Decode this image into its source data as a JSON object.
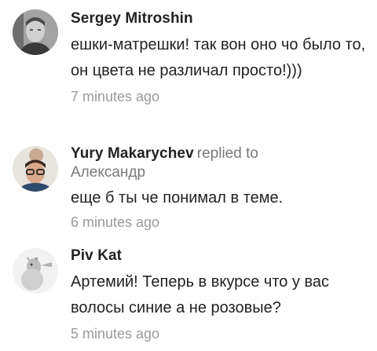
{
  "comments": [
    {
      "author": "Sergey Mitroshin",
      "text": "ешки-матрешки! так вон оно чо было то, он цвета не различал просто!)))",
      "time": "7 minutes ago",
      "avatar_icon": "user-photo-avatar"
    },
    {
      "author": "Yury Makarychev",
      "replied_label": "replied to",
      "reply_target": "Александр",
      "text": "еще б ты че понимал в теме.",
      "time": "6 minutes ago",
      "avatar_icon": "user-photo-avatar"
    },
    {
      "author": "Piv Kat",
      "text": "Артемий! Теперь в вкурсе что у вас волосы синие а не розовые?",
      "time": "5 minutes ago",
      "avatar_icon": "user-photo-avatar"
    }
  ]
}
